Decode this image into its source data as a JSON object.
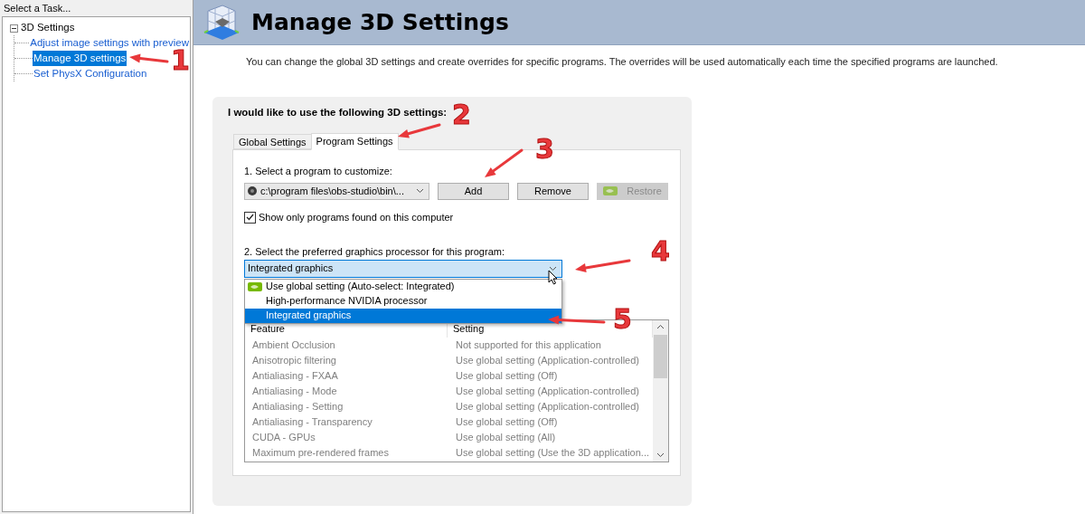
{
  "sidebar": {
    "header": "Select a Task...",
    "tree": [
      {
        "label": "3D Settings",
        "expanded": true,
        "children": [
          {
            "label": "Adjust image settings with preview",
            "selected": false
          },
          {
            "label": "Manage 3D settings",
            "selected": true
          },
          {
            "label": "Set PhysX Configuration",
            "selected": false
          }
        ]
      }
    ]
  },
  "page": {
    "title": "Manage 3D Settings",
    "description": "You can change the global 3D settings and create overrides for specific programs. The overrides will be used automatically each time the specified programs are launched."
  },
  "settings_group": {
    "title": "I would like to use the following 3D settings:",
    "tabs": [
      {
        "label": "Global Settings",
        "selected": false
      },
      {
        "label": "Program Settings",
        "selected": true
      }
    ],
    "program_label": "1. Select a program to customize:",
    "program_select": {
      "value": "c:\\program files\\obs-studio\\bin\\..."
    },
    "buttons": [
      {
        "label": "Add",
        "kind": "plain",
        "disabled": false
      },
      {
        "label": "Remove",
        "kind": "plain",
        "disabled": false
      },
      {
        "label": "Restore",
        "kind": "nvidia",
        "disabled": true
      }
    ],
    "show_only_found": {
      "label": "Show only programs found on this computer",
      "checked": true
    },
    "gpu_label": "2. Select the preferred graphics processor for this program:",
    "gpu_select": {
      "value": "Integrated graphics",
      "expanded": true,
      "options": [
        {
          "label": "Use global setting (Auto-select: Integrated)",
          "kind": "nvidia",
          "selected": false
        },
        {
          "label": "High-performance NVIDIA processor",
          "kind": "plain",
          "selected": false
        },
        {
          "label": "Integrated graphics",
          "kind": "plain",
          "selected": true
        }
      ]
    },
    "table": {
      "disabled": true,
      "columns": [
        "Feature",
        "Setting"
      ],
      "rows": [
        [
          "Ambient Occlusion",
          "Not supported for this application"
        ],
        [
          "Anisotropic filtering",
          "Use global setting (Application-controlled)"
        ],
        [
          "Antialiasing - FXAA",
          "Use global setting (Off)"
        ],
        [
          "Antialiasing - Mode",
          "Use global setting (Application-controlled)"
        ],
        [
          "Antialiasing - Setting",
          "Use global setting (Application-controlled)"
        ],
        [
          "Antialiasing - Transparency",
          "Use global setting (Off)"
        ],
        [
          "CUDA - GPUs",
          "Use global setting (All)"
        ],
        [
          "Maximum pre-rendered frames",
          "Use global setting (Use the 3D application..."
        ]
      ]
    }
  },
  "annotations": [
    {
      "label": "1"
    },
    {
      "label": "2"
    },
    {
      "label": "3"
    },
    {
      "label": "4"
    },
    {
      "label": "5"
    }
  ]
}
